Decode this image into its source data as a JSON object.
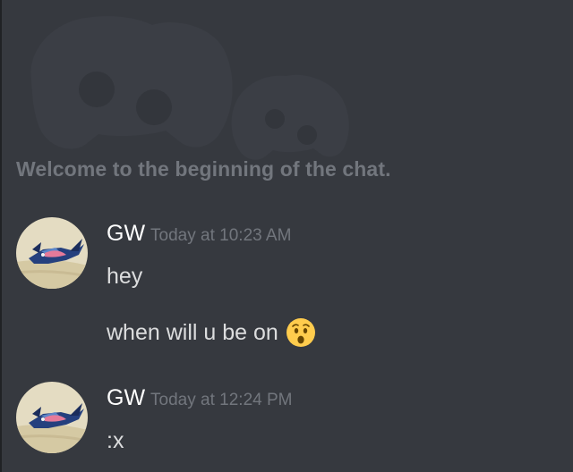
{
  "chat": {
    "welcome_text": "Welcome to the beginning of the chat."
  },
  "messages": [
    {
      "username": "GW",
      "timestamp": "Today at 10:23 AM",
      "lines": [
        "hey",
        "when will u be on"
      ],
      "emoji": "hushed-face"
    },
    {
      "username": "GW",
      "timestamp": "Today at 12:24 PM",
      "lines": [
        ":x"
      ]
    }
  ],
  "colors": {
    "background": "#36393f",
    "username": "#ffffff",
    "message_text": "#dcddde",
    "muted_text": "#72767d"
  }
}
